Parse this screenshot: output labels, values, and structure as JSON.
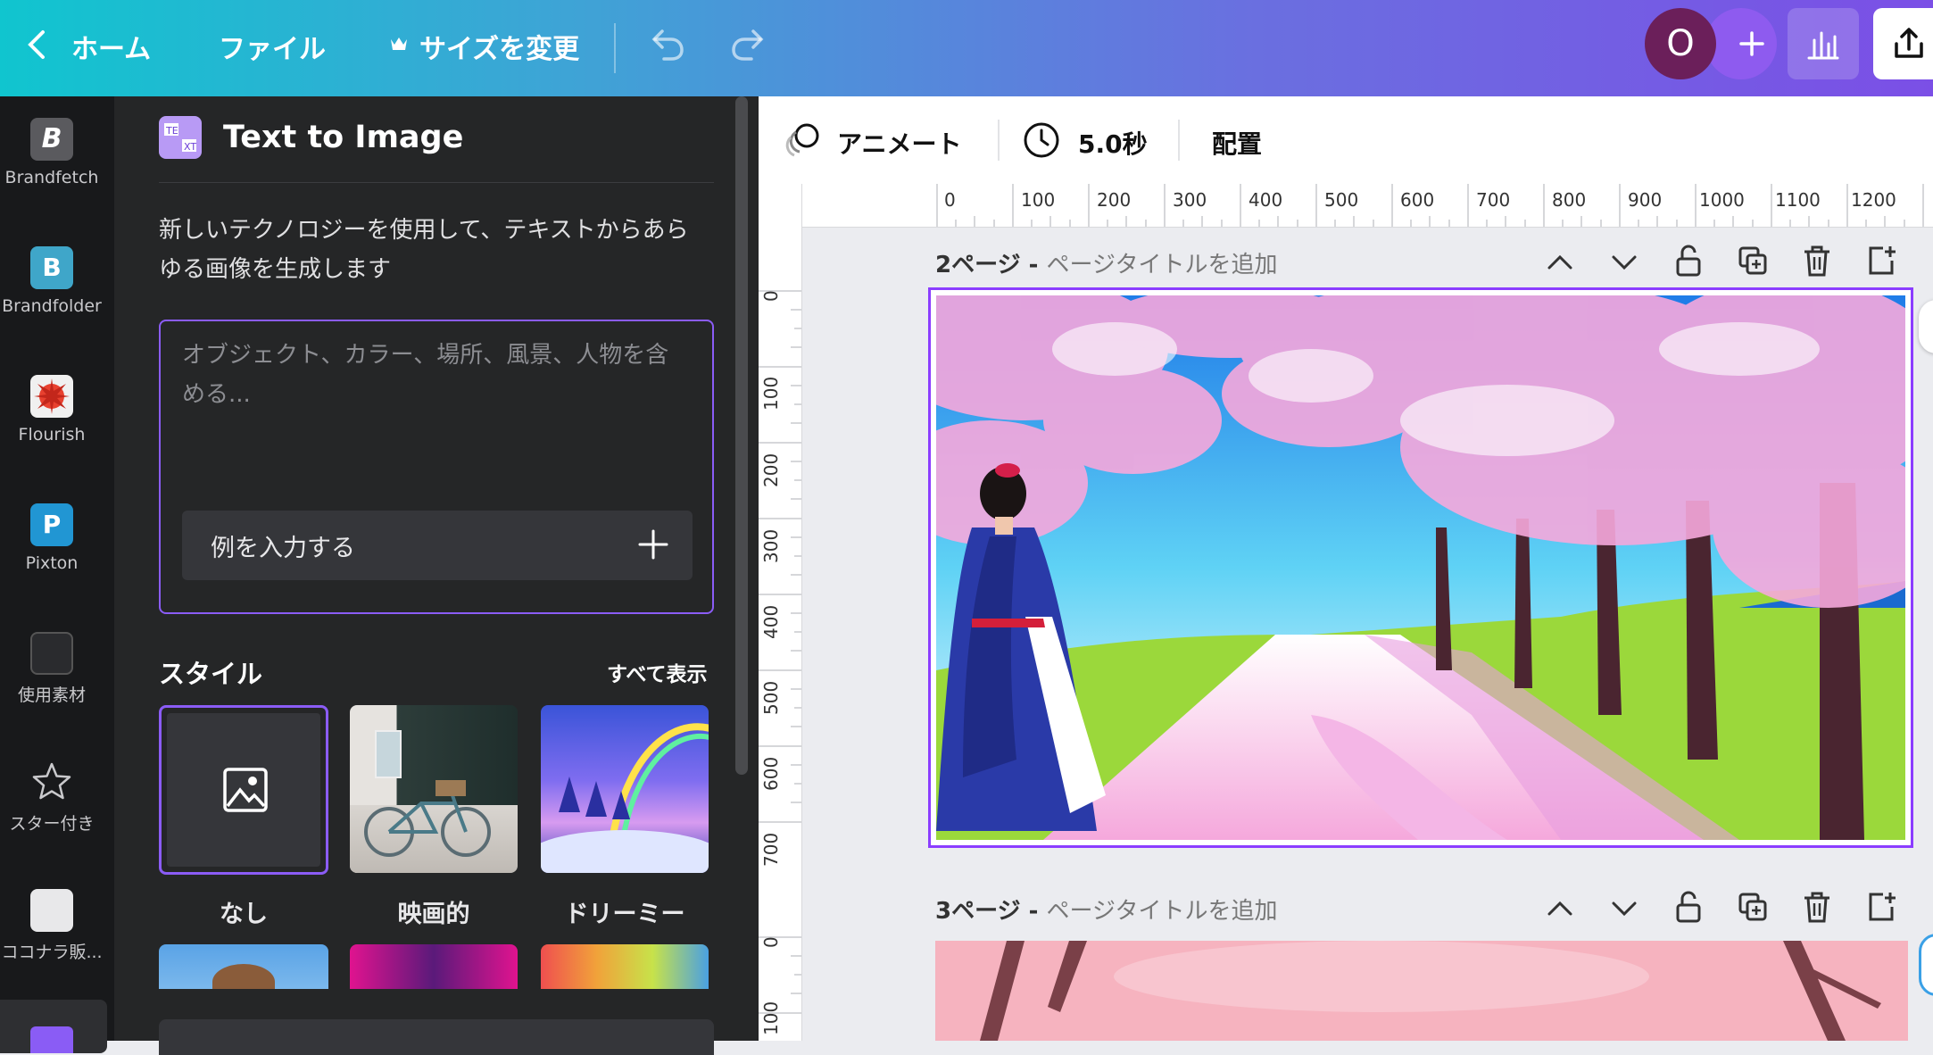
{
  "header": {
    "home_label": "ホーム",
    "file_label": "ファイル",
    "resize_label": "サイズを変更",
    "avatar_letter": "O"
  },
  "rail": {
    "items": [
      {
        "label": "Brandfetch"
      },
      {
        "label": "Brandfolder"
      },
      {
        "label": "Flourish"
      },
      {
        "label": "Pixton"
      },
      {
        "label": "使用素材"
      },
      {
        "label": "スター付き"
      },
      {
        "label": "ココナラ販..."
      }
    ]
  },
  "panel": {
    "title": "Text to Image",
    "description": "新しいテクノロジーを使用して、テキストからあらゆる画像を生成します",
    "prompt_placeholder": "オブジェクト、カラー、場所、風景、人物を含める...",
    "example_label": "例を入力する",
    "style_heading": "スタイル",
    "show_all_label": "すべて表示",
    "styles": [
      {
        "label": "なし"
      },
      {
        "label": "映画的"
      },
      {
        "label": "ドリーミー"
      }
    ]
  },
  "toolbar": {
    "animate_label": "アニメート",
    "duration_label": "5.0秒",
    "arrange_label": "配置"
  },
  "ruler": {
    "top": [
      "0",
      "100",
      "200",
      "300",
      "400",
      "500",
      "600",
      "700",
      "800",
      "900",
      "1000",
      "1100",
      "1200"
    ],
    "left_page2": [
      "0",
      "100",
      "200",
      "300",
      "400",
      "500",
      "600",
      "700"
    ],
    "left_page3": [
      "0",
      "100"
    ]
  },
  "pages": [
    {
      "number_label": "2ページ -",
      "title_placeholder": "ページタイトルを追加"
    },
    {
      "number_label": "3ページ -",
      "title_placeholder": "ページタイトルを追加"
    }
  ],
  "colors": {
    "accent": "#8b3dff",
    "gradient_start": "#10c5cf",
    "gradient_end": "#7b4fe6"
  }
}
